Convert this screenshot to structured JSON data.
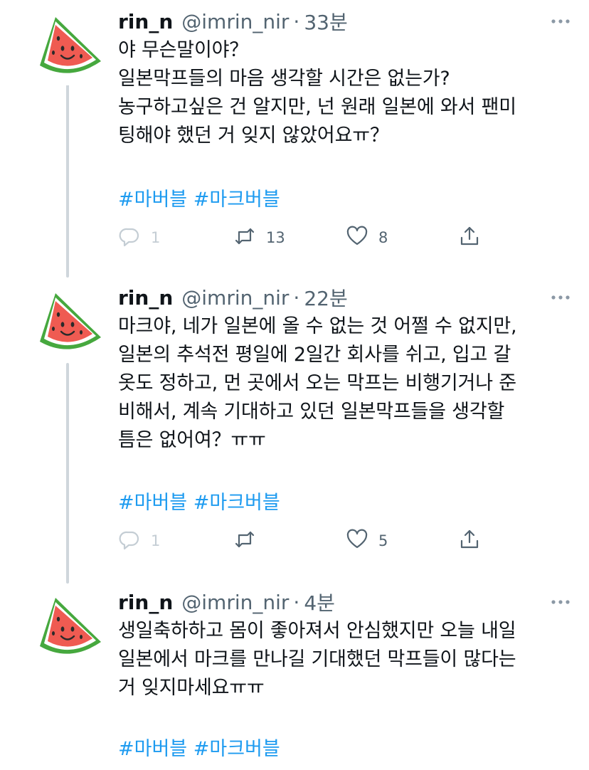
{
  "tweets": [
    {
      "name": "rin_n",
      "handle": "@imrin_nir",
      "separator": "·",
      "time": "33분",
      "lines": [
        "야 무슨말이야？",
        "일본막프들의 마음  생각할 시간은 없는가?",
        "농구하고싶은 건 알지만, 넌 원래 일본에 와서 팬미",
        "팅해야 했던 거 잊지 않았어요ㅠ？"
      ],
      "hashtags": [
        "#마버블",
        "#마크버블"
      ],
      "replies": "1",
      "retweets": "13",
      "likes": "8"
    },
    {
      "name": "rin_n",
      "handle": "@imrin_nir",
      "separator": "·",
      "time": "22분",
      "lines": [
        "마크야, 네가 일본에 올 수 없는 것 어쩔 수 없지만,",
        "일본의 추석전 평일에 2일간 회사를 쉬고, 입고 갈",
        "옷도 정하고, 먼 곳에서 오는 막프는 비행기거나 준",
        "비해서, 계속 기대하고 있던 일본막프들을 생각할",
        "틈은 없어여？ㅠㅠ"
      ],
      "hashtags": [
        "#마버블",
        "#마크버블"
      ],
      "replies": "1",
      "retweets": "",
      "likes": "5"
    },
    {
      "name": "rin_n",
      "handle": "@imrin_nir",
      "separator": "·",
      "time": "4분",
      "lines": [
        "생일축하하고 몸이 좋아져서 안심했지만 오늘 내일",
        "일본에서 마크를 만나길 기대했던 막프들이 많다는",
        "거 잊지마세요ㅠㅠ"
      ],
      "hashtags": [
        "#마버블",
        "#마크버블"
      ]
    }
  ],
  "icons": {
    "avatar": "watermelon-avatar-icon",
    "more": "more-dots-icon",
    "reply": "reply-icon",
    "retweet": "retweet-icon",
    "like": "heart-icon",
    "share": "share-icon"
  },
  "colors": {
    "hashtag": "#1d9bf0",
    "muted": "#536471",
    "thread_line": "#cfd6dc",
    "watermelon_flesh": "#ef5b52",
    "watermelon_rind": "#46a83e"
  }
}
